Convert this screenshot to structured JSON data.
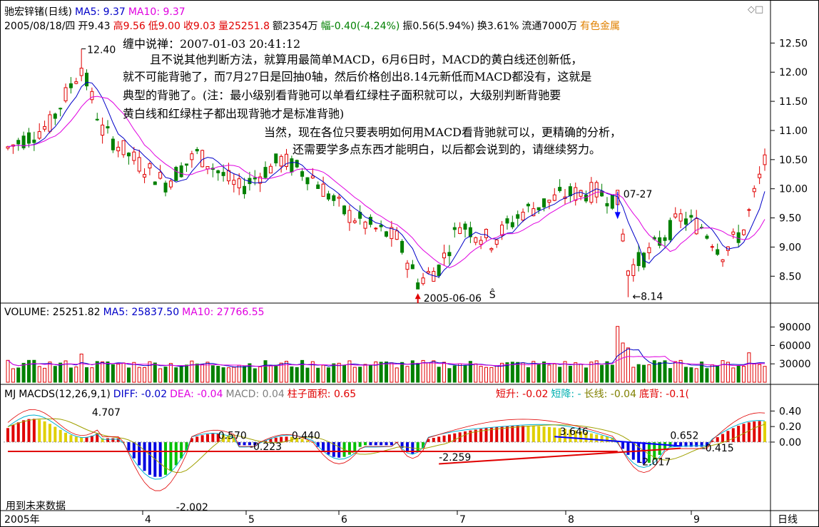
{
  "header": {
    "line1": [
      {
        "text": "驰宏锌锗(日线)",
        "color": "#000000"
      },
      {
        "text": "MA5: 9.37",
        "color": "#0000c8"
      },
      {
        "text": "MA10: 9.37",
        "color": "#e000e0"
      }
    ],
    "line2": [
      {
        "text": "2005/08/18/四",
        "color": "#000000"
      },
      {
        "text": "开9.43",
        "color": "#000000"
      },
      {
        "text": "高9.56",
        "color": "#e00000"
      },
      {
        "text": "低9.00",
        "color": "#e00000"
      },
      {
        "text": "收9.03",
        "color": "#e00000"
      },
      {
        "text": "量25251.8",
        "color": "#e00000"
      },
      {
        "text": "额2354万",
        "color": "#000000"
      },
      {
        "text": "幅-0.40(-4.24%)",
        "color": "#008000"
      },
      {
        "text": "振0.56(5.94%)",
        "color": "#000000"
      },
      {
        "text": "换3.61%",
        "color": "#000000"
      },
      {
        "text": "流通7000万",
        "color": "#000000"
      },
      {
        "text": "有色金属",
        "color": "#e08000"
      }
    ],
    "window_icons": "◇□"
  },
  "note": {
    "title": "缠中说禅：2007-01-03 20:41:12",
    "lines": [
      "且不说其他判断方法，就算用最简单MACD，6月6日时，MACD的黄白线还创新低，",
      "就不可能背驰了，而7月27日是回抽0轴，然后价格创出8.14元新低而MACD都没有，这就是",
      "典型的背驰了。(注：最小级别看背驰可以单看红绿柱子面积就可以，大级别判断背驰要",
      "黄白线和红绿柱子都出现背驰才是标准背驰)",
      "当然，现在各位只要表明如何用MACD看背驰就可以，更精确的分析，",
      "还需要学多点东西才能明白，以后都会说到的，请继续努力。"
    ]
  },
  "annotations": {
    "high_label": "12.40",
    "low1_label": "2005-06-06",
    "low2_label": "8.14",
    "mark_0727": "07-27",
    "s_mark": "Ŝ"
  },
  "volume_header": [
    {
      "text": "VOLUME: 25251.82",
      "color": "#000000"
    },
    {
      "text": "MA5: 25837.50",
      "color": "#0000c8"
    },
    {
      "text": "MA10: 27766.55",
      "color": "#e000e0"
    }
  ],
  "macd_header": [
    {
      "text": "MJ",
      "color": "#000000"
    },
    {
      "text": "MACDS(12,26,9,1)",
      "color": "#000000"
    },
    {
      "text": "DIFF: -0.02",
      "color": "#0000c8"
    },
    {
      "text": "DEA: -0.04",
      "color": "#e000e0"
    },
    {
      "text": "MACD: 0.04",
      "color": "#808080"
    },
    {
      "text": "柱子面积: 0.65",
      "color": "#e00000"
    }
  ],
  "macd_header_right": [
    {
      "text": "短升: -0.02",
      "color": "#e00000"
    },
    {
      "text": "短降: -",
      "color": "#00b0b0"
    },
    {
      "text": "长线: -0.04",
      "color": "#808000"
    },
    {
      "text": "底背: -0.1(",
      "color": "#e00000"
    }
  ],
  "macd_labels": {
    "v1": "4.707",
    "v2": "0.570",
    "v3": "0.440",
    "v4": "-0.223",
    "v5": "-2.259",
    "v6": "3.646",
    "v7": "0.652",
    "v8": "-0.415",
    "v9": "-2.017",
    "v10": "-2.002",
    "footer": "用到未来数据"
  },
  "x_axis": {
    "start": "2005年",
    "labels": [
      "4",
      "5",
      "6",
      "7",
      "8",
      "9"
    ],
    "period": "日线"
  },
  "chart_data": [
    {
      "type": "candlestick",
      "title": "驰宏锌锗(日线)",
      "ylim": [
        8.1,
        12.7
      ],
      "yticks": [
        8.5,
        9.0,
        9.5,
        10.0,
        10.5,
        11.0,
        11.5,
        12.0,
        12.5
      ],
      "series_ma": [
        "MA5",
        "MA10"
      ],
      "anchors": [
        {
          "label": "high",
          "value": 12.4
        },
        {
          "label": "2005-06-06",
          "value": 8.33
        },
        {
          "label": "07-27",
          "value": 9.85
        },
        {
          "label": "low",
          "value": 8.14
        },
        {
          "label": "2005/08/18",
          "open": 9.43,
          "high": 9.56,
          "low": 9.0,
          "close": 9.03
        }
      ]
    },
    {
      "type": "bar",
      "title": "VOLUME",
      "ylim": [
        0,
        100000
      ],
      "yticks": [
        30000,
        60000,
        90000
      ],
      "values_hint": {
        "last": 25251.82,
        "ma5": 25837.5,
        "ma10": 27766.55,
        "max": 90000
      }
    },
    {
      "type": "bar",
      "title": "MACDS(12,26,9,1)",
      "ylim": [
        -0.9,
        0.55
      ],
      "yticks": [
        0.0,
        0.2,
        0.4
      ],
      "values_hint": {
        "diff": -0.02,
        "dea": -0.04,
        "macd": 0.04
      }
    }
  ]
}
